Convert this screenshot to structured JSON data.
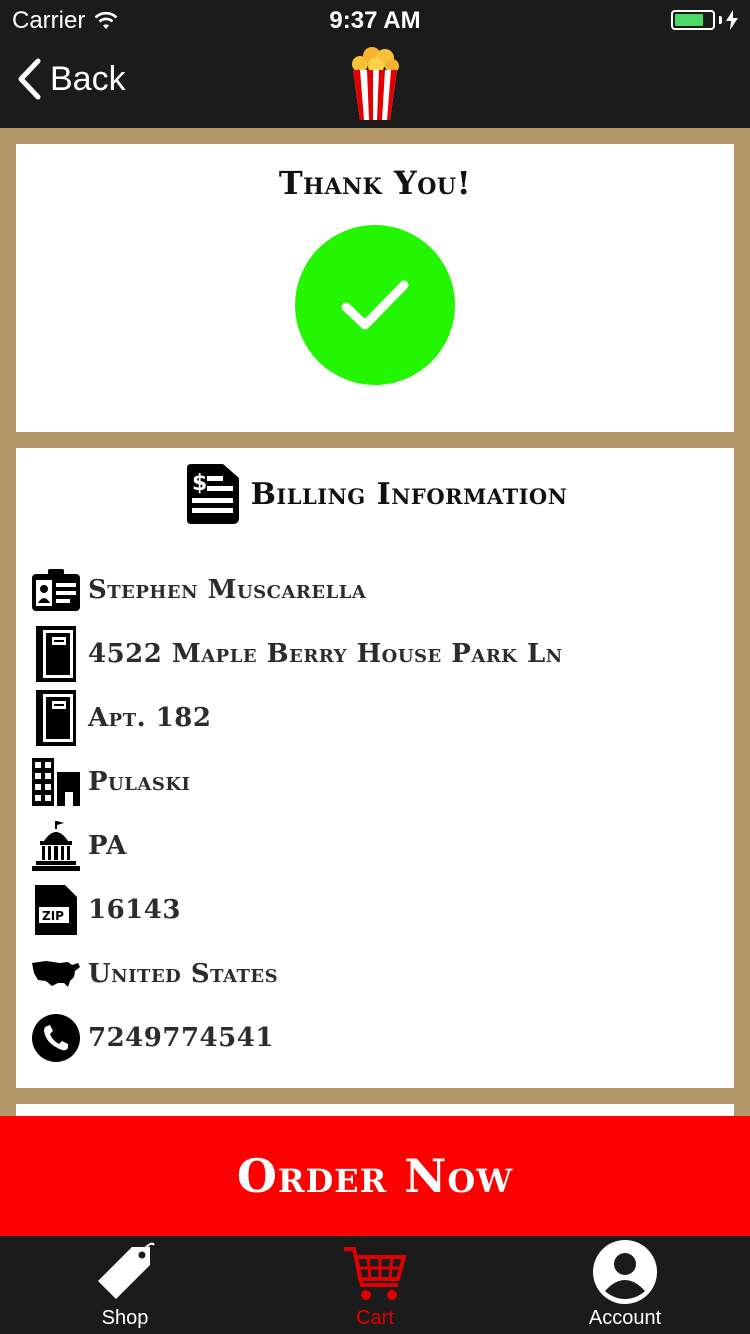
{
  "status": {
    "carrier": "Carrier",
    "time": "9:37 AM"
  },
  "nav": {
    "back_label": "Back"
  },
  "thanks": {
    "title": "Thank You!"
  },
  "billing": {
    "title": "Billing Information",
    "name": "Stephen Muscarella",
    "address1": "4522 Maple Berry House Park Ln",
    "address2": "Apt. 182",
    "city": "Pulaski",
    "state": "PA",
    "zip": "16143",
    "country": "United States",
    "phone": "7249774541"
  },
  "order_button": "Order Now",
  "tabs": [
    {
      "label": "Shop",
      "icon": "tag-icon"
    },
    {
      "label": "Cart",
      "icon": "cart-icon"
    },
    {
      "label": "Account",
      "icon": "account-icon"
    }
  ],
  "colors": {
    "accent": "#fd0000",
    "success": "#24f500",
    "frame": "#b4986a",
    "bar": "#1b1b1b"
  }
}
